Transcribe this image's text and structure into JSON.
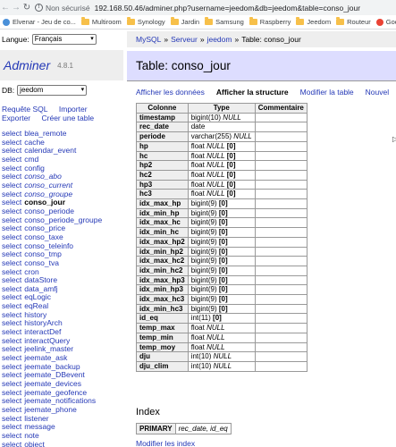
{
  "browser": {
    "secure_label": "Non sécurisé",
    "url": "192.168.50.46/adminer.php?username=jeedom&db=jeedom&table=conso_jour",
    "bookmarks": [
      "Elvenar - Jeu de co...",
      "Multiroom",
      "Synology",
      "Jardin",
      "Samsung",
      "Raspberry",
      "Jeedom",
      "Routeur",
      "Google Hom"
    ]
  },
  "sidebar": {
    "language_label": "Langue:",
    "language_value": "Français",
    "logo": "Adminer",
    "version": "4.8.1",
    "db_label": "DB:",
    "db_value": "jeedom",
    "links": {
      "sql_command": "Requête SQL",
      "import": "Importer",
      "export": "Exporter",
      "create_table": "Créer une table"
    },
    "select_label": "select",
    "tables": [
      {
        "name": "blea_remote",
        "view": false,
        "active": false
      },
      {
        "name": "cache",
        "view": false,
        "active": false
      },
      {
        "name": "calendar_event",
        "view": false,
        "active": false
      },
      {
        "name": "cmd",
        "view": false,
        "active": false
      },
      {
        "name": "config",
        "view": false,
        "active": false
      },
      {
        "name": "conso_abo",
        "view": true,
        "active": false
      },
      {
        "name": "conso_current",
        "view": true,
        "active": false
      },
      {
        "name": "conso_groupe",
        "view": true,
        "active": false
      },
      {
        "name": "conso_jour",
        "view": false,
        "active": true
      },
      {
        "name": "conso_periode",
        "view": false,
        "active": false
      },
      {
        "name": "conso_periode_groupe",
        "view": false,
        "active": false
      },
      {
        "name": "conso_price",
        "view": false,
        "active": false
      },
      {
        "name": "conso_taxe",
        "view": false,
        "active": false
      },
      {
        "name": "conso_teleinfo",
        "view": false,
        "active": false
      },
      {
        "name": "conso_tmp",
        "view": false,
        "active": false
      },
      {
        "name": "conso_tva",
        "view": false,
        "active": false
      },
      {
        "name": "cron",
        "view": false,
        "active": false
      },
      {
        "name": "dataStore",
        "view": false,
        "active": false
      },
      {
        "name": "data_amfj",
        "view": false,
        "active": false
      },
      {
        "name": "eqLogic",
        "view": false,
        "active": false
      },
      {
        "name": "eqReal",
        "view": false,
        "active": false
      },
      {
        "name": "history",
        "view": false,
        "active": false
      },
      {
        "name": "historyArch",
        "view": false,
        "active": false
      },
      {
        "name": "interactDef",
        "view": false,
        "active": false
      },
      {
        "name": "interactQuery",
        "view": false,
        "active": false
      },
      {
        "name": "jeelink_master",
        "view": false,
        "active": false
      },
      {
        "name": "jeemate_ask",
        "view": false,
        "active": false
      },
      {
        "name": "jeemate_backup",
        "view": false,
        "active": false
      },
      {
        "name": "jeemate_DBevent",
        "view": false,
        "active": false
      },
      {
        "name": "jeemate_devices",
        "view": false,
        "active": false
      },
      {
        "name": "jeemate_geofence",
        "view": false,
        "active": false
      },
      {
        "name": "jeemate_notifications",
        "view": false,
        "active": false
      },
      {
        "name": "jeemate_phone",
        "view": false,
        "active": false
      },
      {
        "name": "listener",
        "view": false,
        "active": false
      },
      {
        "name": "message",
        "view": false,
        "active": false
      },
      {
        "name": "note",
        "view": false,
        "active": false
      },
      {
        "name": "object",
        "view": false,
        "active": false
      }
    ]
  },
  "breadcrumb": {
    "items": [
      "MySQL",
      "Serveur",
      "jeedom"
    ],
    "separator": "»",
    "current": "Table: conso_jour"
  },
  "heading": "Table: conso_jour",
  "actions": [
    {
      "label": "Afficher les données",
      "active": false
    },
    {
      "label": "Afficher la structure",
      "active": true
    },
    {
      "label": "Modifier la table",
      "active": false
    },
    {
      "label": "Nouvel",
      "active": false
    }
  ],
  "structure": {
    "headers": [
      "Colonne",
      "Type",
      "Commentaire"
    ],
    "rows": [
      {
        "name": "timestamp",
        "type": "bigint(10)",
        "null": "NULL",
        "default": ""
      },
      {
        "name": "rec_date",
        "type": "date",
        "null": "",
        "default": ""
      },
      {
        "name": "periode",
        "type": "varchar(255)",
        "null": "NULL",
        "default": ""
      },
      {
        "name": "hp",
        "type": "float",
        "null": "NULL",
        "default": "[0]"
      },
      {
        "name": "hc",
        "type": "float",
        "null": "NULL",
        "default": "[0]"
      },
      {
        "name": "hp2",
        "type": "float",
        "null": "NULL",
        "default": "[0]"
      },
      {
        "name": "hc2",
        "type": "float",
        "null": "NULL",
        "default": "[0]"
      },
      {
        "name": "hp3",
        "type": "float",
        "null": "NULL",
        "default": "[0]"
      },
      {
        "name": "hc3",
        "type": "float",
        "null": "NULL",
        "default": "[0]"
      },
      {
        "name": "idx_max_hp",
        "type": "bigint(9)",
        "null": "",
        "default": "[0]"
      },
      {
        "name": "idx_min_hp",
        "type": "bigint(9)",
        "null": "",
        "default": "[0]"
      },
      {
        "name": "idx_max_hc",
        "type": "bigint(9)",
        "null": "",
        "default": "[0]"
      },
      {
        "name": "idx_min_hc",
        "type": "bigint(9)",
        "null": "",
        "default": "[0]"
      },
      {
        "name": "idx_max_hp2",
        "type": "bigint(9)",
        "null": "",
        "default": "[0]"
      },
      {
        "name": "idx_min_hp2",
        "type": "bigint(9)",
        "null": "",
        "default": "[0]"
      },
      {
        "name": "idx_max_hc2",
        "type": "bigint(9)",
        "null": "",
        "default": "[0]"
      },
      {
        "name": "idx_min_hc2",
        "type": "bigint(9)",
        "null": "",
        "default": "[0]"
      },
      {
        "name": "idx_max_hp3",
        "type": "bigint(9)",
        "null": "",
        "default": "[0]"
      },
      {
        "name": "idx_min_hp3",
        "type": "bigint(9)",
        "null": "",
        "default": "[0]"
      },
      {
        "name": "idx_max_hc3",
        "type": "bigint(9)",
        "null": "",
        "default": "[0]"
      },
      {
        "name": "idx_min_hc3",
        "type": "bigint(9)",
        "null": "",
        "default": "[0]"
      },
      {
        "name": "id_eq",
        "type": "int(11)",
        "null": "",
        "default": "[0]"
      },
      {
        "name": "temp_max",
        "type": "float",
        "null": "NULL",
        "default": ""
      },
      {
        "name": "temp_min",
        "type": "float",
        "null": "NULL",
        "default": ""
      },
      {
        "name": "temp_moy",
        "type": "float",
        "null": "NULL",
        "default": ""
      },
      {
        "name": "dju",
        "type": "int(10)",
        "null": "NULL",
        "default": ""
      },
      {
        "name": "dju_clim",
        "type": "int(10)",
        "null": "NULL",
        "default": ""
      }
    ]
  },
  "indexes": {
    "title": "Index",
    "rows": [
      {
        "type": "PRIMARY",
        "columns": "rec_date, id_eq"
      }
    ],
    "modify_label": "Modifier les index"
  },
  "colors": {
    "link": "#2438b6",
    "heading_bg": "#ddddff",
    "header_bg": "#eeeeee",
    "border": "#999999"
  }
}
